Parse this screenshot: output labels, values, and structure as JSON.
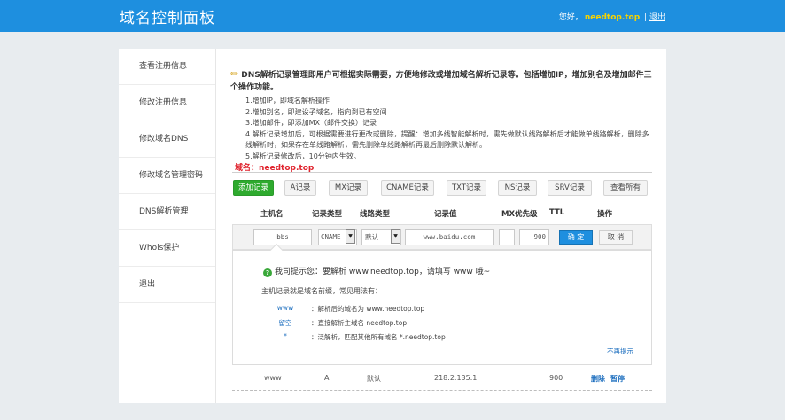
{
  "header": {
    "title": "域名控制面板",
    "greeting": "您好，",
    "username": "needtop.top",
    "separator": "|",
    "logout": "退出"
  },
  "sidebar": {
    "items": [
      {
        "label": "查看注册信息"
      },
      {
        "label": "修改注册信息"
      },
      {
        "label": "修改域名DNS"
      },
      {
        "label": "修改域名管理密码"
      },
      {
        "label": "DNS解析管理"
      },
      {
        "label": "Whois保护"
      },
      {
        "label": "退出"
      }
    ]
  },
  "intro": {
    "lead": "DNS解析记录管理即用户可根据实际需要，方便地修改或增加域名解析记录等。包括增加IP，增加别名及增加邮件三个操作功能。",
    "items": [
      "1.增加IP，即域名解析操作",
      "2.增加别名，即建设子域名，指向到已有空间",
      "3.增加邮件，即添加MX（邮件交换）记录",
      "4.解析记录增加后，可根据需要进行更改或删除，提醒：增加多线智能解析时，需先做默认线路解析后才能做单线路解析，删除多",
      "线解析时，如果存在单线路解析，需先删除单线路解析再最后删除默认解析。",
      "5.解析记录修改后，10分钟内生效。"
    ]
  },
  "domain": {
    "label": "域名：needtop.top"
  },
  "tabs": [
    {
      "label": "添加记录"
    },
    {
      "label": "A记录"
    },
    {
      "label": "MX记录"
    },
    {
      "label": "CNAME记录"
    },
    {
      "label": "TXT记录"
    },
    {
      "label": "NS记录"
    },
    {
      "label": "SRV记录"
    },
    {
      "label": "查看所有"
    }
  ],
  "table": {
    "headers": [
      "主机名",
      "记录类型",
      "线路类型",
      "记录值",
      "MX优先级",
      "TTL",
      "操作"
    ]
  },
  "form": {
    "host": "bbs",
    "type": "CNAME",
    "line": "默认",
    "value": "www.baidu.com",
    "mx": "",
    "ttl": "900",
    "confirm": "确 定",
    "cancel": "取 消"
  },
  "tip": {
    "title": "我司提示您：要解析 www.needtop.top，请填写 www 哦~",
    "subtitle": "主机记录就是域名前缀，常见用法有：",
    "rows": [
      {
        "key": "www",
        "desc": "：解析后的域名为 www.needtop.top"
      },
      {
        "key": "留空",
        "desc": "：直接解析主域名 needtop.top"
      },
      {
        "key": "*",
        "desc": "：泛解析，匹配其他所有域名 *.needtop.top"
      }
    ],
    "dismiss": "不再提示"
  },
  "record": {
    "host": "www",
    "type": "A",
    "line": "默认",
    "value": "218.2.135.1",
    "ttl": "900",
    "delete": "删除",
    "pause": "暂停"
  },
  "colors": {
    "header": "#1e8fdf",
    "active_tab": "#2eaa2e",
    "domain_label": "#e0242e",
    "username": "#f7d300",
    "link": "#1e6fbf"
  }
}
